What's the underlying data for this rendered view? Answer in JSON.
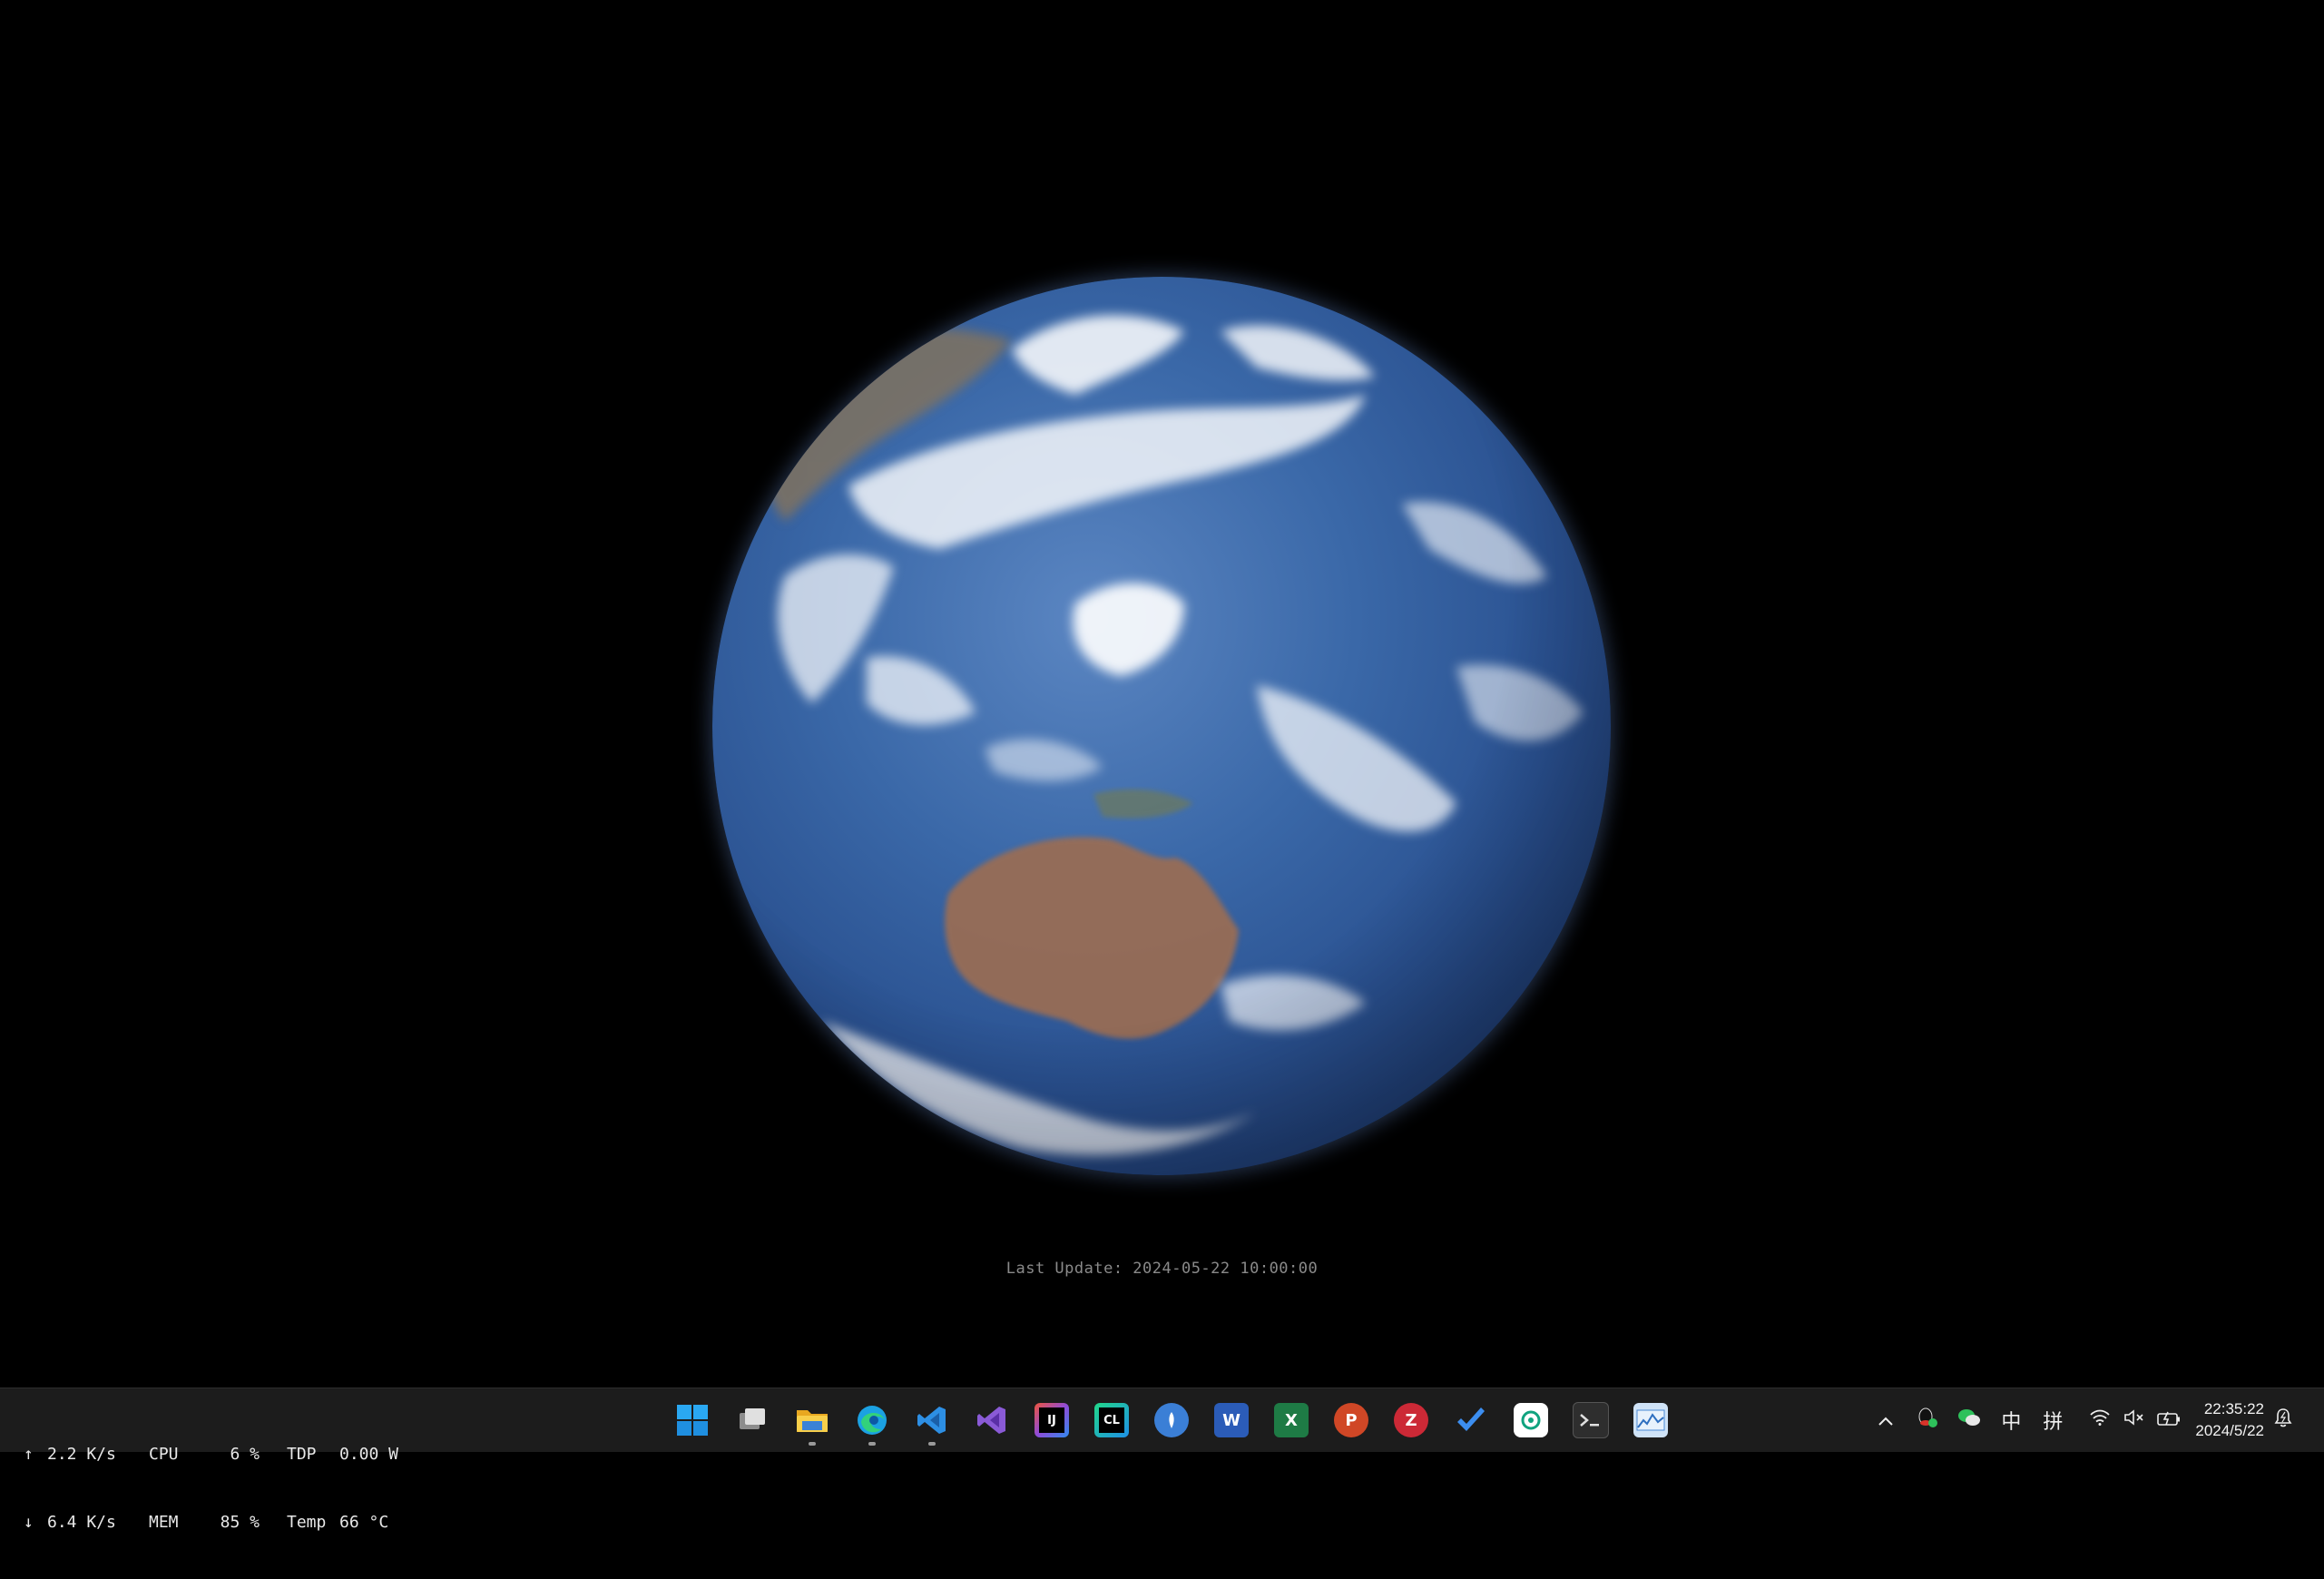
{
  "wallpaper": {
    "description_icon": "earth-satellite-image",
    "last_update": "Last Update: 2024-05-22 10:00:00"
  },
  "monitor": {
    "up_arrow": "↑",
    "up_speed": "2.2 K/s",
    "down_arrow": "↓",
    "down_speed": "6.4 K/s",
    "cpu_label": "CPU",
    "cpu_value": "6 %",
    "mem_label": "MEM",
    "mem_value": "85 %",
    "tdp_label": "TDP",
    "tdp_value": "0.00 W",
    "temp_label": "Temp",
    "temp_value": "66 °C"
  },
  "taskbar": {
    "apps": [
      {
        "name": "start",
        "icon": "windows-icon",
        "color": "#1f9bf0",
        "running": false
      },
      {
        "name": "task-view",
        "icon": "task-view-icon",
        "color": "#cfcfcf",
        "running": false
      },
      {
        "name": "file-explorer",
        "icon": "folder-icon",
        "color": "#f4c542",
        "running": true
      },
      {
        "name": "edge",
        "icon": "edge-icon",
        "color": "#1ba1e2",
        "running": true
      },
      {
        "name": "vscode",
        "icon": "vscode-icon",
        "color": "#2d8fe4",
        "running": true
      },
      {
        "name": "visual-studio",
        "icon": "visual-studio-icon",
        "color": "#8a5ad6",
        "running": false
      },
      {
        "name": "intellij",
        "icon": "intellij-icon",
        "color": "#f0553c",
        "running": false
      },
      {
        "name": "clion",
        "icon": "clion-icon",
        "color": "#21d789",
        "running": false
      },
      {
        "name": "typora",
        "icon": "pen-icon",
        "color": "#3b7fd6",
        "running": false
      },
      {
        "name": "word",
        "icon": "word-icon",
        "color": "#2b5cb8",
        "running": false
      },
      {
        "name": "excel",
        "icon": "excel-icon",
        "color": "#1e7b45",
        "running": false
      },
      {
        "name": "powerpoint",
        "icon": "powerpoint-icon",
        "color": "#d04726",
        "running": false
      },
      {
        "name": "zotero",
        "icon": "zotero-icon",
        "color": "#cc2936",
        "running": false
      },
      {
        "name": "todo",
        "icon": "checkmark-icon",
        "color": "#3c8ef0",
        "running": false
      },
      {
        "name": "chatgpt",
        "icon": "chatgpt-icon",
        "color": "#e8e8e8",
        "running": false
      },
      {
        "name": "terminal",
        "icon": "terminal-icon",
        "color": "#3a3a3a",
        "running": false
      },
      {
        "name": "resource-monitor",
        "icon": "chart-icon",
        "color": "#4a8ad6",
        "running": false
      }
    ],
    "tray": {
      "ime_lang": "中",
      "ime_mode": "拼",
      "time": "22:35:22",
      "date": "2024/5/22"
    },
    "labels": {
      "cl": "CL",
      "ij": "IJ",
      "w": "W",
      "x": "X",
      "p": "P",
      "z": "Z"
    }
  }
}
